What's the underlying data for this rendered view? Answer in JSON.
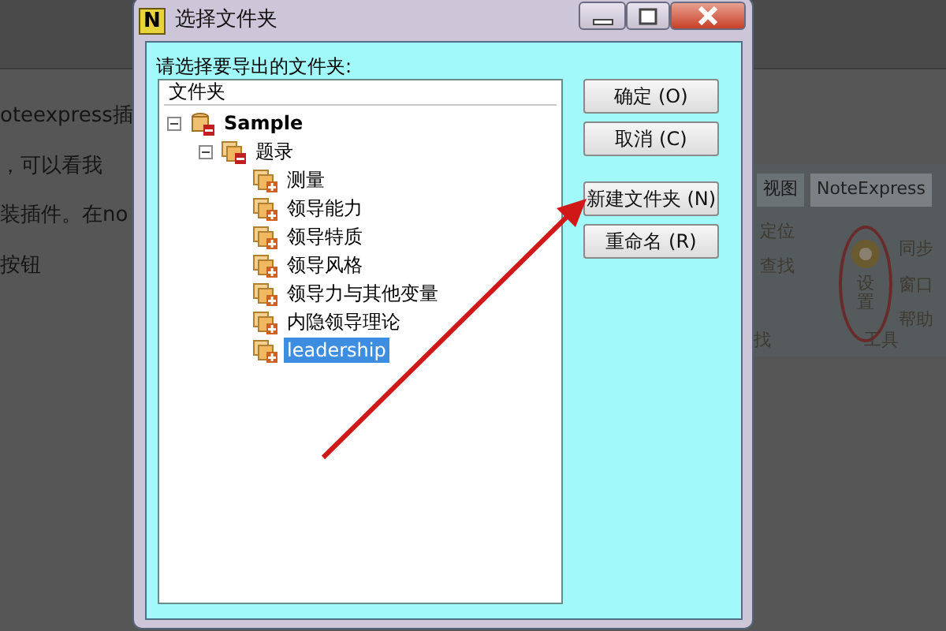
{
  "background": {
    "article_lines": [
      "oteexpress插",
      "，可以看我",
      "装插件。在no",
      "按钮"
    ],
    "ribbon": {
      "tabs": [
        {
          "label": "视图",
          "selected": false
        },
        {
          "label": "NoteExpress",
          "selected": true
        }
      ],
      "left_items": [
        "定位",
        "查找"
      ],
      "left_group": "找",
      "big_button": "设置",
      "right_items": [
        "同步",
        "窗口",
        "帮助"
      ],
      "right_group": "工具"
    }
  },
  "dialog": {
    "app_icon": "N",
    "title": "选择文件夹",
    "prompt": "请选择要导出的文件夹:",
    "tree_header": "文件夹",
    "tree": [
      {
        "label": "Sample",
        "kind": "library",
        "expanded": true,
        "selected": false,
        "children": [
          {
            "label": "题录",
            "kind": "folder",
            "expanded": true,
            "selected": false,
            "children": [
              {
                "label": "测量",
                "kind": "leaf",
                "selected": false
              },
              {
                "label": "领导能力",
                "kind": "leaf",
                "selected": false
              },
              {
                "label": "领导特质",
                "kind": "leaf",
                "selected": false
              },
              {
                "label": "领导风格",
                "kind": "leaf",
                "selected": false
              },
              {
                "label": "领导力与其他变量",
                "kind": "leaf",
                "selected": false
              },
              {
                "label": "内隐领导理论",
                "kind": "leaf",
                "selected": false
              },
              {
                "label": "leadership",
                "kind": "leaf",
                "selected": true
              }
            ]
          }
        ]
      }
    ],
    "buttons": [
      "确定 (O)",
      "取消 (C)",
      "新建文件夹 (N)",
      "重命名 (R)"
    ]
  }
}
